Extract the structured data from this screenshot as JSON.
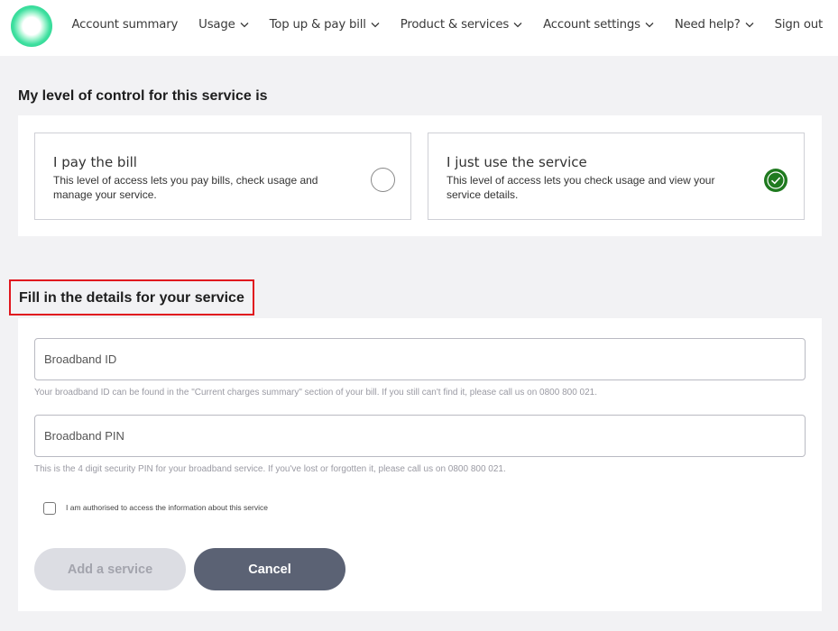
{
  "nav": {
    "items": [
      {
        "label": "Account summary",
        "dropdown": false
      },
      {
        "label": "Usage",
        "dropdown": true
      },
      {
        "label": "Top up & pay bill",
        "dropdown": true
      },
      {
        "label": "Product & services",
        "dropdown": true
      },
      {
        "label": "Account settings",
        "dropdown": true
      },
      {
        "label": "Need help?",
        "dropdown": true
      },
      {
        "label": "Sign out",
        "dropdown": false
      }
    ]
  },
  "control": {
    "title": "My level of control for this service is",
    "options": [
      {
        "title": "I pay the bill",
        "description": "This level of access lets you pay bills, check usage and manage your service.",
        "selected": false
      },
      {
        "title": "I just use the service",
        "description": "This level of access lets you check usage and view your service details.",
        "selected": true
      }
    ]
  },
  "details": {
    "title": "Fill in the details for your service",
    "broadband_id": {
      "placeholder": "Broadband ID",
      "value": "",
      "help": "Your broadband ID can be found in the \"Current charges summary\" section of your bill. If you still can't find it, please call us on 0800 800 021."
    },
    "broadband_pin": {
      "placeholder": "Broadband PIN",
      "value": "",
      "help": "This is the 4 digit security PIN for your broadband service. If you've lost or forgotten it, please call us on 0800 800 021."
    },
    "authorised": {
      "label": "I am authorised to access the information about this service",
      "checked": false
    }
  },
  "buttons": {
    "add": "Add a service",
    "cancel": "Cancel"
  },
  "colors": {
    "accent_check": "#1f7a1f",
    "highlight": "#e0161e",
    "cancel_button": "#5b6274",
    "add_button_disabled": "#dcdde3",
    "logo": "#3fe0a0"
  }
}
